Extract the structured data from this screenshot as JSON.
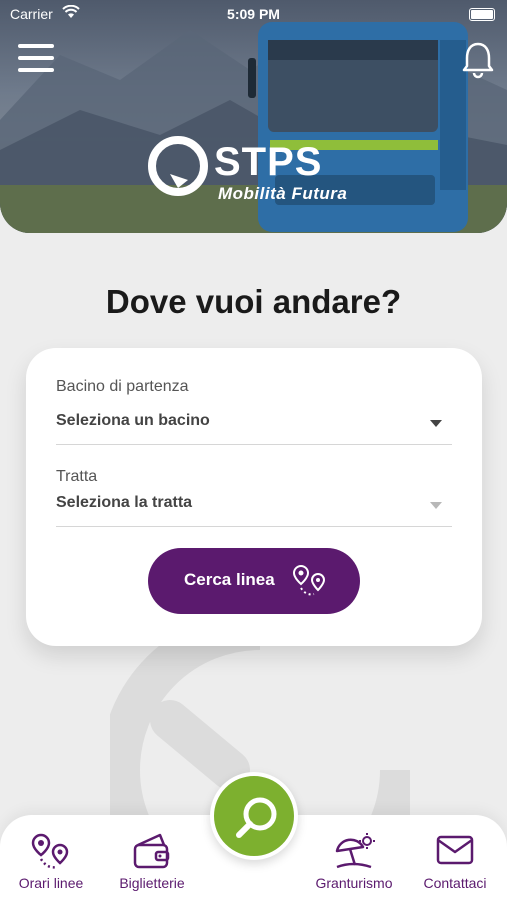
{
  "status_bar": {
    "carrier": "Carrier",
    "time": "5:09 PM"
  },
  "header": {
    "brand": "STPS",
    "tagline": "Mobilità Futura",
    "menu_icon": "hamburger-menu-icon",
    "notification_icon": "bell-icon"
  },
  "main": {
    "title": "Dove vuoi andare?",
    "form": {
      "bacino_label": "Bacino di partenza",
      "bacino_value": "Seleziona un bacino",
      "tratta_label": "Tratta",
      "tratta_value": "Seleziona la tratta",
      "search_button": "Cerca linea"
    }
  },
  "bottom_nav": {
    "items": [
      {
        "label": "Orari linee",
        "icon": "route-pins-icon"
      },
      {
        "label": "Biglietterie",
        "icon": "wallet-icon"
      },
      {
        "label": "Granturismo",
        "icon": "beach-umbrella-icon"
      },
      {
        "label": "Contattaci",
        "icon": "envelope-icon"
      }
    ],
    "center_button_icon": "search-icon"
  },
  "colors": {
    "brand_purple": "#5b1a6e",
    "accent_green": "#7db02f",
    "background": "#ededed"
  }
}
